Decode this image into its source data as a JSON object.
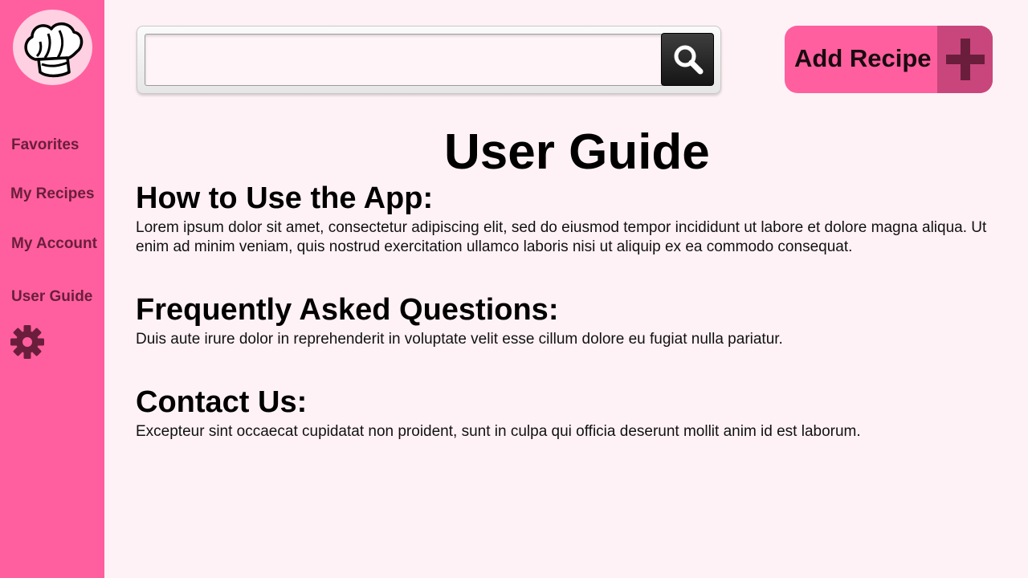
{
  "sidebar": {
    "logo_icon": "chef-hat-icon",
    "items": [
      {
        "label": "Favorites"
      },
      {
        "label": "My Recipes"
      },
      {
        "label": "My Account"
      },
      {
        "label": "User Guide"
      }
    ],
    "settings_icon": "gear-icon"
  },
  "search": {
    "value": "",
    "placeholder": "",
    "button_icon": "search-icon"
  },
  "add_recipe": {
    "label": "Add Recipe",
    "icon": "plus-icon"
  },
  "main": {
    "title": "User Guide",
    "sections": [
      {
        "heading": "How to Use the App:",
        "body": "Lorem ipsum dolor sit amet, consectetur adipiscing elit, sed do eiusmod tempor incididunt ut labore et dolore magna aliqua. Ut enim ad minim veniam, quis nostrud exercitation ullamco laboris nisi ut aliquip ex ea commodo consequat."
      },
      {
        "heading": "Frequently Asked Questions:",
        "body": "Duis aute irure dolor in reprehenderit in voluptate velit esse cillum dolore eu fugiat nulla pariatur."
      },
      {
        "heading": "Contact Us:",
        "body": "Excepteur sint occaecat cupidatat non proident, sunt in culpa qui officia deserunt mollit anim id est laborum."
      }
    ]
  },
  "colors": {
    "sidebar": "#ff5f9e",
    "background": "#fff2f6",
    "nav_text": "#6a1e3c",
    "accent_dark": "#c8467c"
  }
}
